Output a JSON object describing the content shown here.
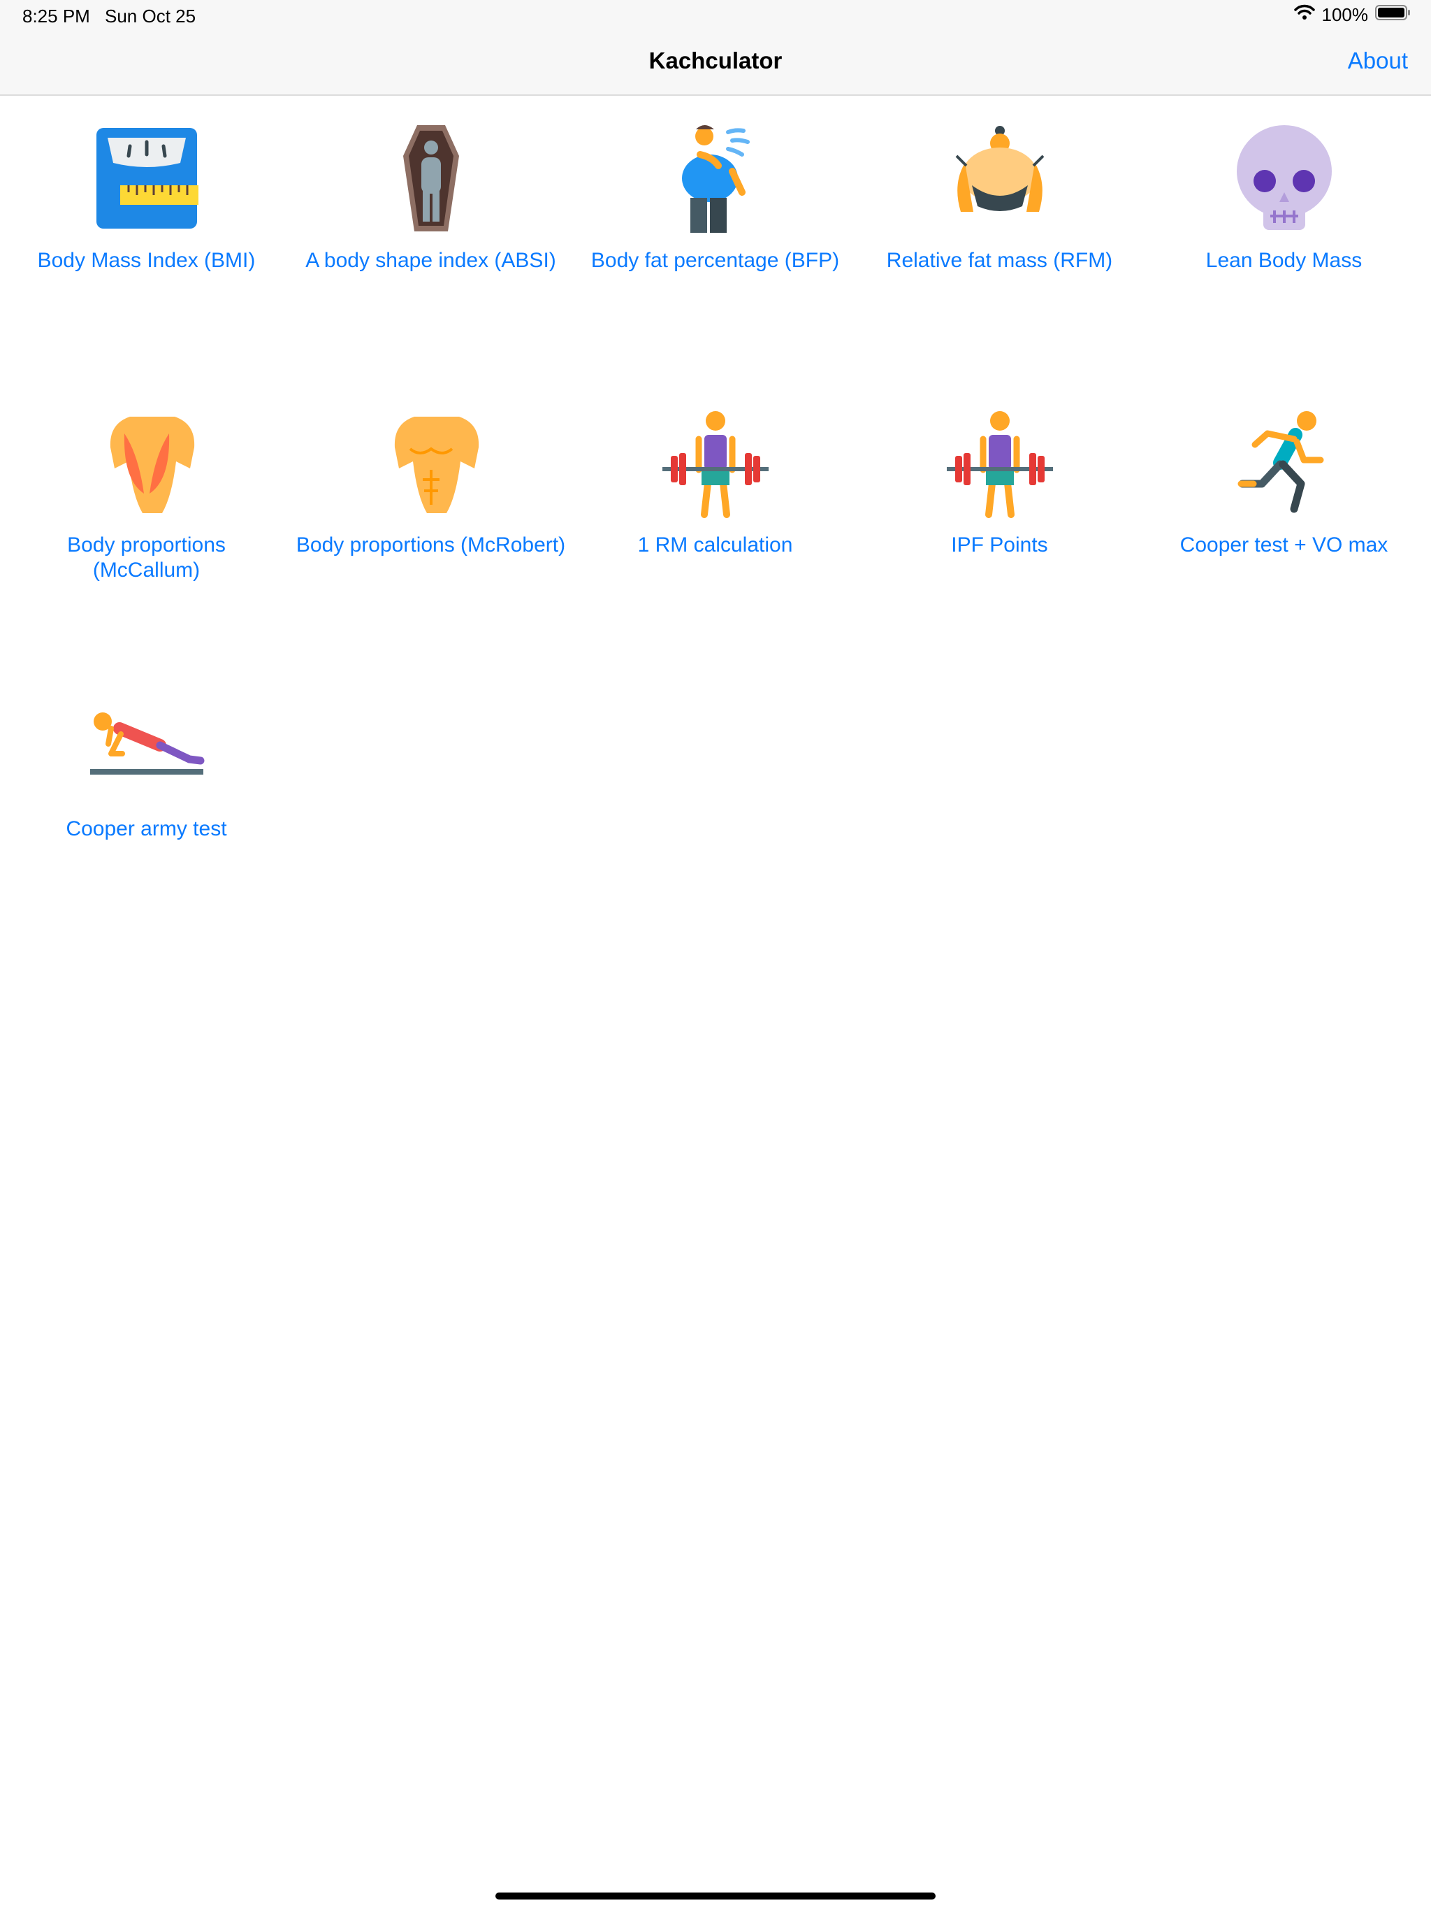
{
  "status_bar": {
    "time": "8:25 PM",
    "date": "Sun Oct 25",
    "battery": "100%",
    "icons": [
      "wifi-icon",
      "battery-icon"
    ]
  },
  "nav": {
    "title": "Kachculator",
    "about": "About"
  },
  "tiles": [
    {
      "label": "Body Mass Index (BMI)",
      "icon": "scale-icon"
    },
    {
      "label": "A body shape index (ABSI)",
      "icon": "coffin-icon"
    },
    {
      "label": "Body fat percentage (BFP)",
      "icon": "sweating-person-icon"
    },
    {
      "label": "Relative fat mass (RFM)",
      "icon": "sumo-wrestler-icon"
    },
    {
      "label": "Lean Body Mass",
      "icon": "skull-icon"
    },
    {
      "label": "Body proportions (McCallum)",
      "icon": "back-muscles-icon"
    },
    {
      "label": "Body proportions (McRobert)",
      "icon": "torso-muscles-icon"
    },
    {
      "label": "1 RM calculation",
      "icon": "weightlifter-icon"
    },
    {
      "label": "IPF Points",
      "icon": "weightlifter-icon"
    },
    {
      "label": "Cooper test + VO max",
      "icon": "runner-icon"
    },
    {
      "label": "Cooper army test",
      "icon": "pushup-icon"
    }
  ]
}
